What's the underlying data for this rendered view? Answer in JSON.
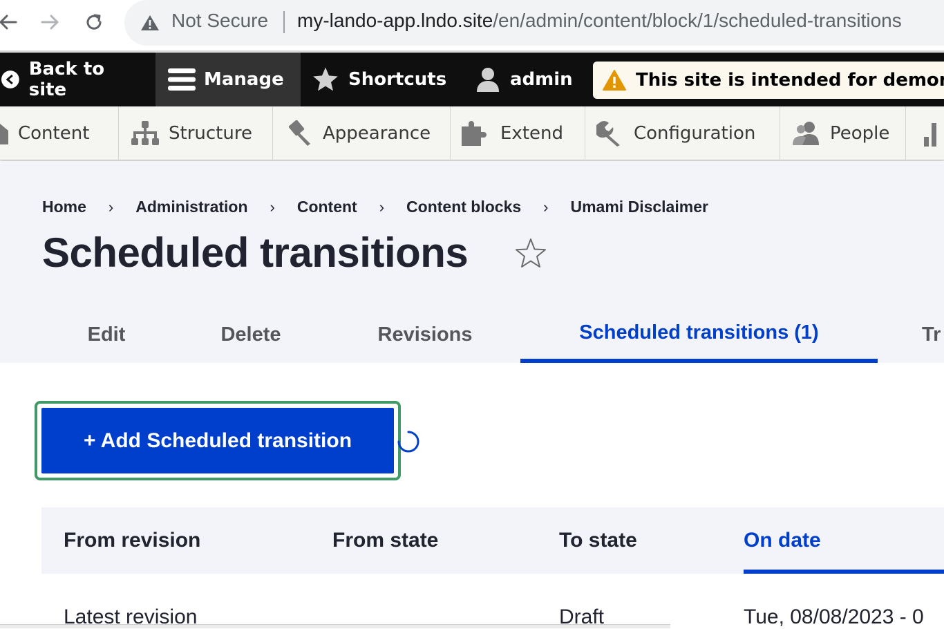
{
  "browser": {
    "security_label": "Not Secure",
    "url_host": "my-lando-app.lndo.site",
    "url_path": "/en/admin/content/block/1/scheduled-transitions"
  },
  "toolbar": {
    "back_to_site": "Back to site",
    "manage": "Manage",
    "shortcuts": "Shortcuts",
    "user": "admin",
    "demo_notice": "This site is intended for demonstration purposes only."
  },
  "tray": {
    "items": [
      "Content",
      "Structure",
      "Appearance",
      "Extend",
      "Configuration",
      "People"
    ]
  },
  "breadcrumb": {
    "items": [
      "Home",
      "Administration",
      "Content",
      "Content blocks",
      "Umami Disclaimer"
    ],
    "separator": "›"
  },
  "page": {
    "title": "Scheduled transitions"
  },
  "tabs": {
    "items": [
      "Edit",
      "Delete",
      "Revisions",
      "Scheduled transitions (1)",
      "Tr"
    ]
  },
  "actions": {
    "add_label": "+ Add Scheduled transition"
  },
  "table": {
    "headers": [
      "From revision",
      "From state",
      "To state",
      "On date"
    ],
    "rows": [
      [
        "Latest revision",
        "",
        "Draft",
        "Tue, 08/08/2023 - 0"
      ]
    ]
  },
  "colors": {
    "accent": "#003ecc",
    "focus_ring": "#3f9a68",
    "toolbar_bg": "#0f0f0f",
    "header_bg": "#f3f4f9"
  },
  "icons": {
    "back": "arrow-left-icon",
    "forward": "arrow-right-icon",
    "reload": "reload-icon",
    "warning": "warning-triangle-icon",
    "manage": "hamburger-icon",
    "shortcuts": "star-icon",
    "user": "user-icon",
    "favorite": "star-outline-icon"
  }
}
